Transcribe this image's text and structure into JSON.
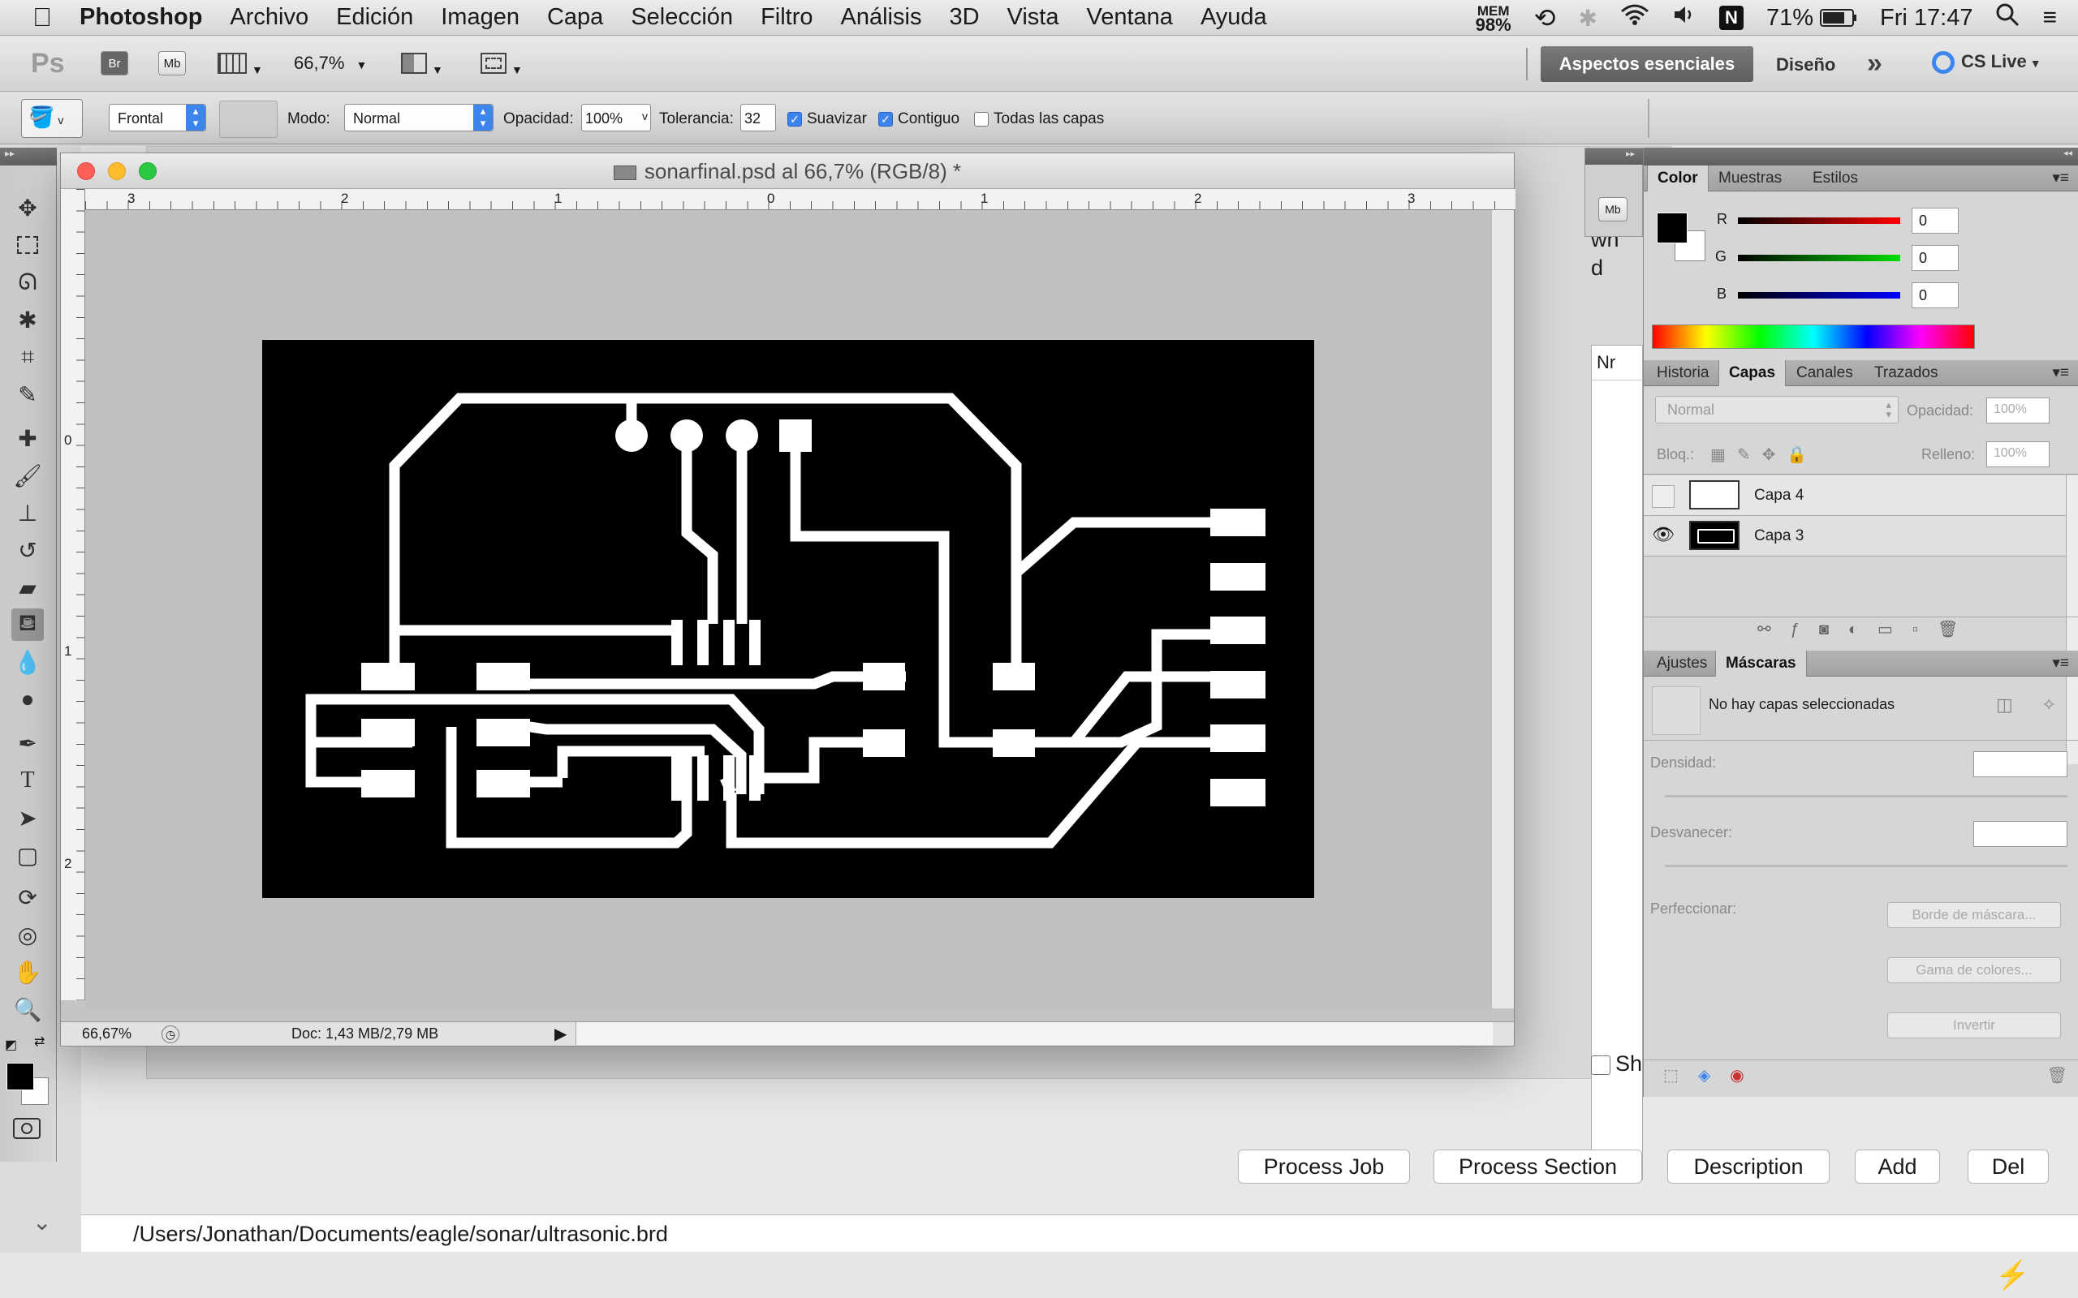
{
  "menubar": {
    "app_name": "Photoshop",
    "items": [
      "Archivo",
      "Edición",
      "Imagen",
      "Capa",
      "Selección",
      "Filtro",
      "Análisis",
      "3D",
      "Vista",
      "Ventana",
      "Ayuda"
    ],
    "mem_label": "MEM",
    "mem_value": "98%",
    "battery": "71%",
    "clock": "Fri 17:47"
  },
  "appbar": {
    "ps_logo": "Ps",
    "br_label": "Br",
    "mb_label": "Mb",
    "zoom": "66,7%",
    "workspace_active": "Aspectos esenciales",
    "workspace_other": "Diseño",
    "more": "»",
    "cslive": "CS Live"
  },
  "options": {
    "fill_source": "Frontal",
    "mode_label": "Modo:",
    "mode_value": "Normal",
    "opacity_label": "Opacidad:",
    "opacity_value": "100%",
    "tolerance_label": "Tolerancia:",
    "tolerance_value": "32",
    "smooth_label": "Suavizar",
    "contiguous_label": "Contiguo",
    "all_layers_label": "Todas las capas"
  },
  "document": {
    "title": "sonarfinal.psd al 66,7% (RGB/8) *",
    "zoom": "66,67%",
    "doc_info": "Doc: 1,43 MB/2,79 MB",
    "hruler_labels": [
      "3",
      "2",
      "1",
      "0",
      "1",
      "2",
      "3"
    ],
    "vruler_labels": [
      "0",
      "1",
      "2"
    ]
  },
  "color_panel": {
    "tabs": [
      "Color",
      "Muestras",
      "Estilos"
    ],
    "active_tab": "Color",
    "r_label": "R",
    "r_value": "0",
    "g_label": "G",
    "g_value": "0",
    "b_label": "B",
    "b_value": "0",
    "foreground": "#000000",
    "background": "#ffffff"
  },
  "layers_panel": {
    "tabs": [
      "Historia",
      "Capas",
      "Canales",
      "Trazados"
    ],
    "active_tab": "Capas",
    "blend_mode": "Normal",
    "opacity_label": "Opacidad:",
    "opacity_value": "100%",
    "lock_label": "Bloq.:",
    "fill_label": "Relleno:",
    "fill_value": "100%",
    "layers": [
      {
        "name": "Capa 4",
        "visible": false
      },
      {
        "name": "Capa 3",
        "visible": true
      }
    ]
  },
  "masks_panel": {
    "tabs": [
      "Ajustes",
      "Máscaras"
    ],
    "active_tab": "Máscaras",
    "message": "No hay capas seleccionadas",
    "density_label": "Densidad:",
    "feather_label": "Desvanecer:",
    "refine_label": "Perfeccionar:",
    "mask_edge_btn": "Borde de máscara...",
    "color_range_btn": "Gama de colores...",
    "invert_btn": "Invertir"
  },
  "background_app": {
    "buttons": [
      "Process Job",
      "Process Section",
      "Description",
      "Add",
      "Del"
    ],
    "path": "/Users/Jonathan/Documents/eagle/sonar/ultrasonic.brd",
    "list_header": "Nr",
    "partial_text_1": "wn",
    "partial_text_2": "d",
    "partial_checkbox_label": "Sh"
  },
  "colors": {
    "accent": "#3d86f0",
    "pcb_background": "#000000",
    "pcb_trace": "#ffffff",
    "canvas_gray": "#c0c0c0"
  }
}
